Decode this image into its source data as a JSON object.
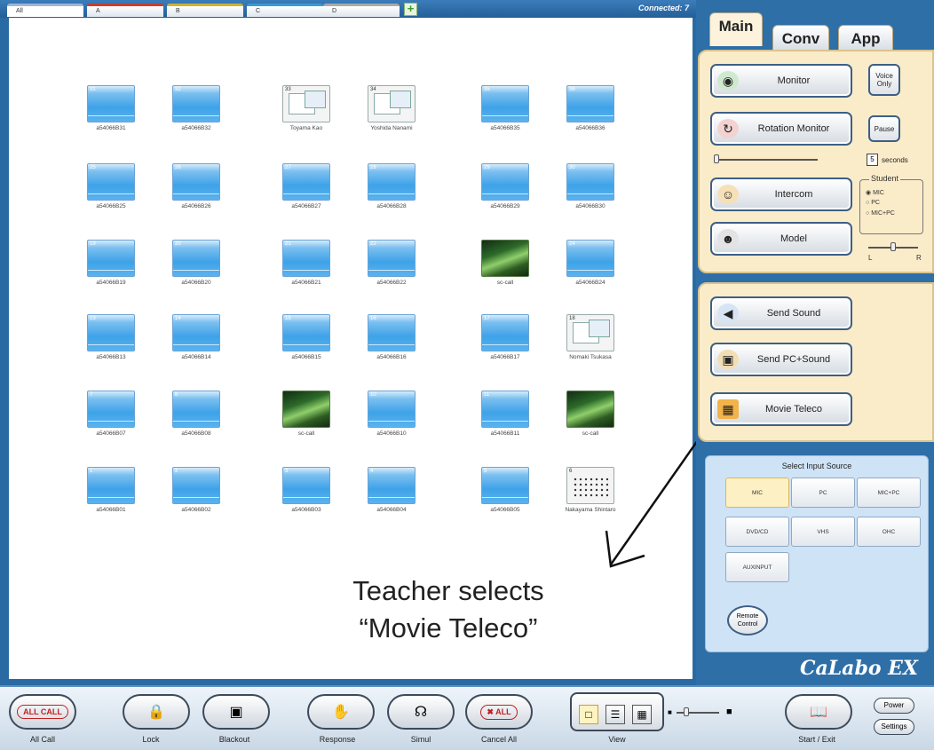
{
  "group_tabs": [
    "All",
    "A",
    "B",
    "C",
    "D"
  ],
  "status": {
    "connected": "Connected: 7"
  },
  "seats": [
    {
      "num": "31",
      "label": "a54066B31",
      "kind": "blank"
    },
    {
      "num": "32",
      "label": "a54066B32",
      "kind": "blank"
    },
    {
      "num": "33",
      "label": "Toyama Kao",
      "kind": "desk"
    },
    {
      "num": "34",
      "label": "Yoshida Nanami",
      "kind": "desk"
    },
    {
      "num": "35",
      "label": "a54066B35",
      "kind": "blank"
    },
    {
      "num": "36",
      "label": "a54066B36",
      "kind": "blank"
    },
    {
      "num": "25",
      "label": "a54066B25",
      "kind": "blank"
    },
    {
      "num": "26",
      "label": "a54066B26",
      "kind": "blank"
    },
    {
      "num": "27",
      "label": "a54066B27",
      "kind": "blank"
    },
    {
      "num": "28",
      "label": "a54066B28",
      "kind": "blank"
    },
    {
      "num": "29",
      "label": "a54066B29",
      "kind": "blank"
    },
    {
      "num": "30",
      "label": "a54066B30",
      "kind": "blank"
    },
    {
      "num": "19",
      "label": "a54066B19",
      "kind": "blank"
    },
    {
      "num": "20",
      "label": "a54066B20",
      "kind": "blank"
    },
    {
      "num": "21",
      "label": "a54066B21",
      "kind": "blank"
    },
    {
      "num": "22",
      "label": "a54066B22",
      "kind": "blank"
    },
    {
      "num": "23",
      "label": "sc-call",
      "kind": "video"
    },
    {
      "num": "24",
      "label": "a54066B24",
      "kind": "blank"
    },
    {
      "num": "13",
      "label": "a54066B13",
      "kind": "blank"
    },
    {
      "num": "14",
      "label": "a54066B14",
      "kind": "blank"
    },
    {
      "num": "15",
      "label": "a54066B15",
      "kind": "blank"
    },
    {
      "num": "16",
      "label": "a54066B16",
      "kind": "blank"
    },
    {
      "num": "17",
      "label": "a54066B17",
      "kind": "blank"
    },
    {
      "num": "18",
      "label": "Nomaki Tsukasa",
      "kind": "desk"
    },
    {
      "num": "7",
      "label": "a54066B07",
      "kind": "blank"
    },
    {
      "num": "8",
      "label": "a54066B08",
      "kind": "blank"
    },
    {
      "num": "9",
      "label": "sc-call",
      "kind": "video"
    },
    {
      "num": "10",
      "label": "a54066B10",
      "kind": "blank"
    },
    {
      "num": "11",
      "label": "a54066B11",
      "kind": "blank"
    },
    {
      "num": "12",
      "label": "sc-call",
      "kind": "video"
    },
    {
      "num": "1",
      "label": "a54066B01",
      "kind": "blank"
    },
    {
      "num": "2",
      "label": "a54066B02",
      "kind": "blank"
    },
    {
      "num": "3",
      "label": "a54066B03",
      "kind": "blank"
    },
    {
      "num": "4",
      "label": "a54066B04",
      "kind": "blank"
    },
    {
      "num": "5",
      "label": "a54066B05",
      "kind": "blank"
    },
    {
      "num": "6",
      "label": "Nakayama Shintaro",
      "kind": "grid"
    }
  ],
  "annotation": {
    "line1": "Teacher selects",
    "line2": "“Movie Teleco”"
  },
  "panel": {
    "tabs": [
      "Main",
      "Conv",
      "App"
    ],
    "monitor": "Monitor",
    "voice_only": "Voice Only",
    "rotation_monitor": "Rotation Monitor",
    "pause": "Pause",
    "seconds_value": "5",
    "seconds_label": "seconds",
    "intercom": "Intercom",
    "model": "Model",
    "student_title": "Student",
    "student_opts": [
      "MIC",
      "PC",
      "MIC+PC"
    ],
    "left": "L",
    "right": "R",
    "send_sound": "Send Sound",
    "send_pc_sound": "Send PC+Sound",
    "movie_teleco": "Movie Teleco",
    "input_title": "Select Input Source",
    "inputs": [
      "MIC",
      "PC",
      "MIC+PC",
      "DVD/CD",
      "VHS",
      "OHC",
      "AUXINPUT"
    ],
    "remote_control": "Remote Control",
    "logo": "CaLabo EX"
  },
  "toolbar": {
    "all_call_chip": "ALL CALL",
    "all_call": "All Call",
    "lock": "Lock",
    "blackout": "Blackout",
    "response": "Response",
    "simul": "Simul",
    "cancel_chip": "ALL",
    "cancel_all": "Cancel All",
    "view": "View",
    "start_exit": "Start / Exit",
    "power": "Power",
    "settings": "Settings"
  },
  "colors": {
    "accent": "#2e6fa8",
    "panel_bg": "#fbecc9",
    "selected": "#fdf0c4"
  }
}
